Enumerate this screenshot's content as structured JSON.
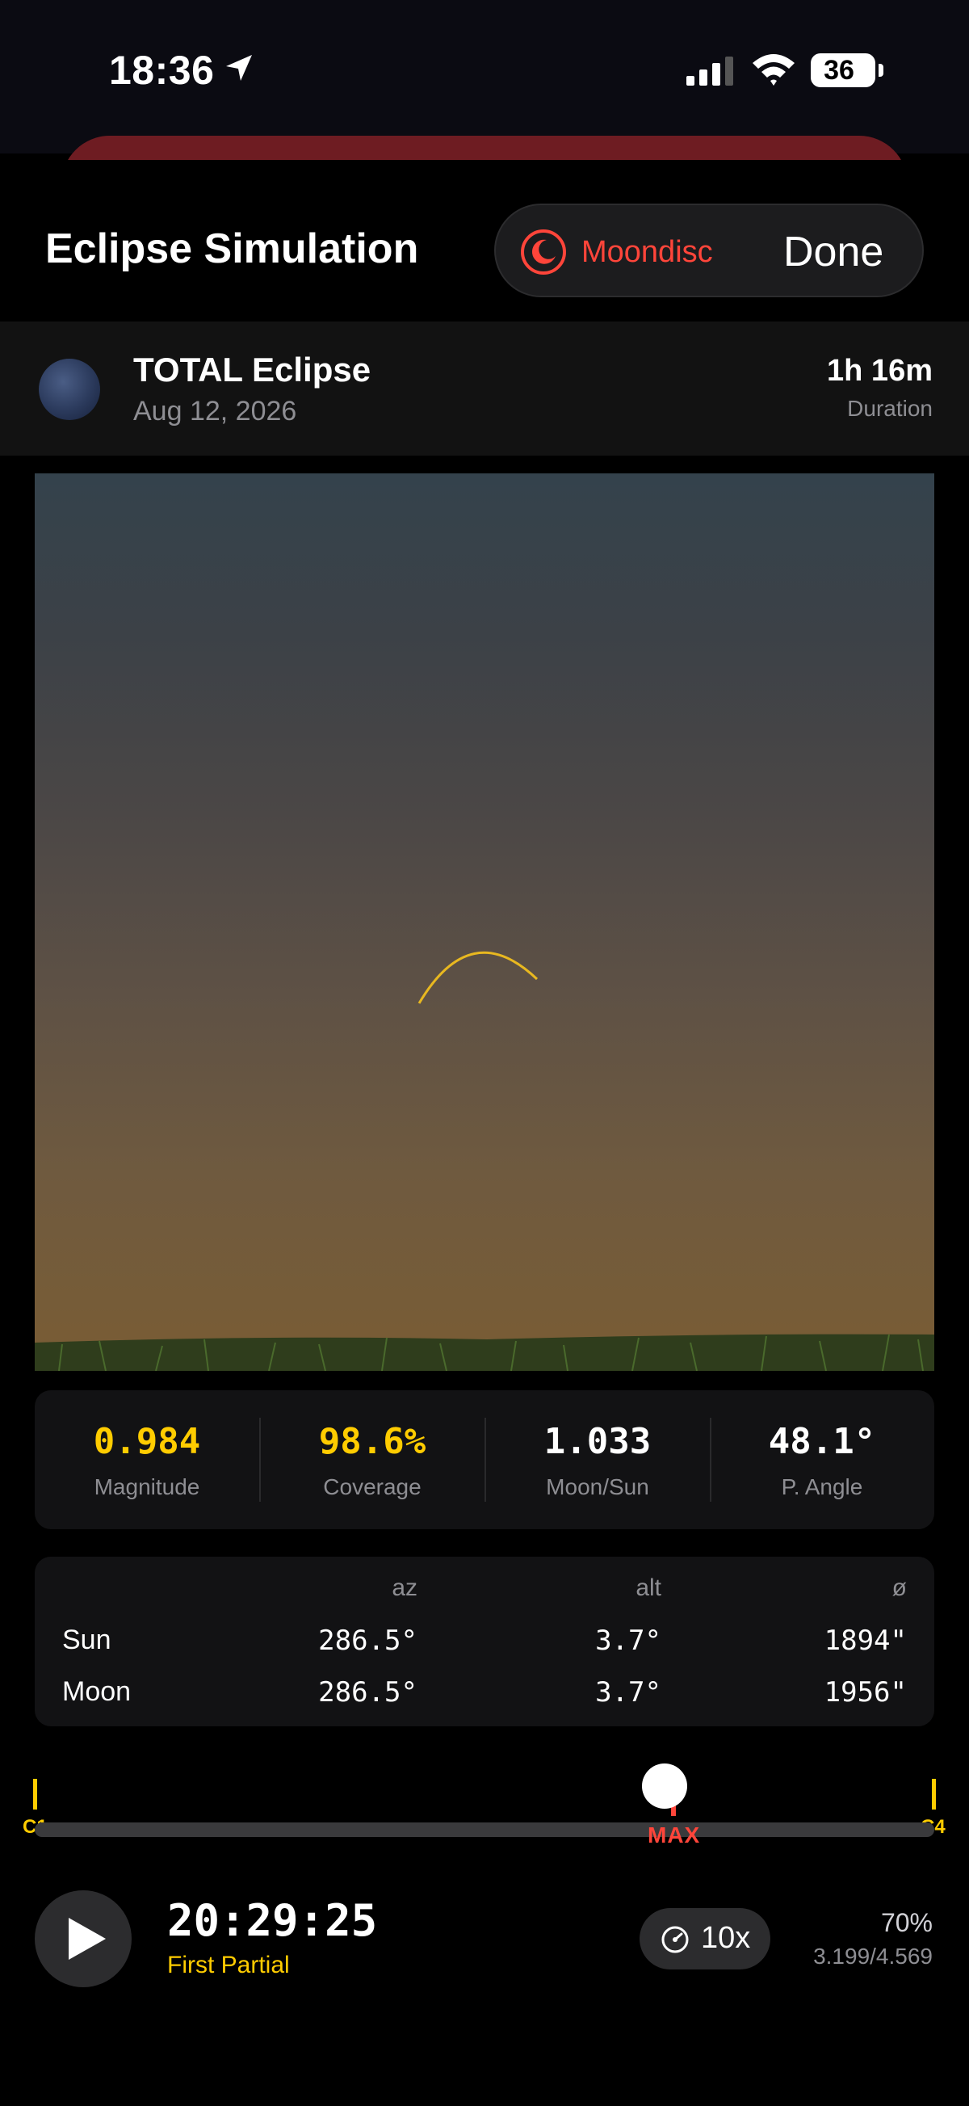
{
  "status_bar": {
    "time": "18:36",
    "battery": "36",
    "icons": [
      "location-arrow-icon",
      "cellular-signal-icon",
      "wifi-icon",
      "battery-icon"
    ]
  },
  "header": {
    "title": "Eclipse Simulation",
    "moondisc_label": "Moondisc",
    "done_label": "Done",
    "accent_color": "#ff453a"
  },
  "event": {
    "title": "TOTAL Eclipse",
    "date": "Aug 12, 2026",
    "duration": "1h 16m",
    "duration_label": "Duration"
  },
  "stats": [
    {
      "value": "0.984",
      "label": "Magnitude",
      "color": "#ffcc00"
    },
    {
      "value": "98.6%",
      "label": "Coverage",
      "color": "#ffcc00"
    },
    {
      "value": "1.033",
      "label": "Moon/Sun",
      "color": "#ffffff"
    },
    {
      "value": "48.1°",
      "label": "P. Angle",
      "color": "#ffffff"
    }
  ],
  "positions": {
    "headers": [
      "az",
      "alt",
      "ø"
    ],
    "rows": [
      {
        "name": "Sun",
        "az": "286.5°",
        "alt": "3.7°",
        "diam": "1894\""
      },
      {
        "name": "Moon",
        "az": "286.5°",
        "alt": "3.7°",
        "diam": "1956\""
      }
    ]
  },
  "timeline": {
    "start_label": "C1",
    "end_label": "C4",
    "max_label": "MAX",
    "progress": 0.7,
    "max_position": 0.71
  },
  "playback": {
    "time": "20:29:25",
    "phase": "First Partial",
    "speed": "10x",
    "percent": "70%",
    "ratio": "3.199/4.569"
  }
}
